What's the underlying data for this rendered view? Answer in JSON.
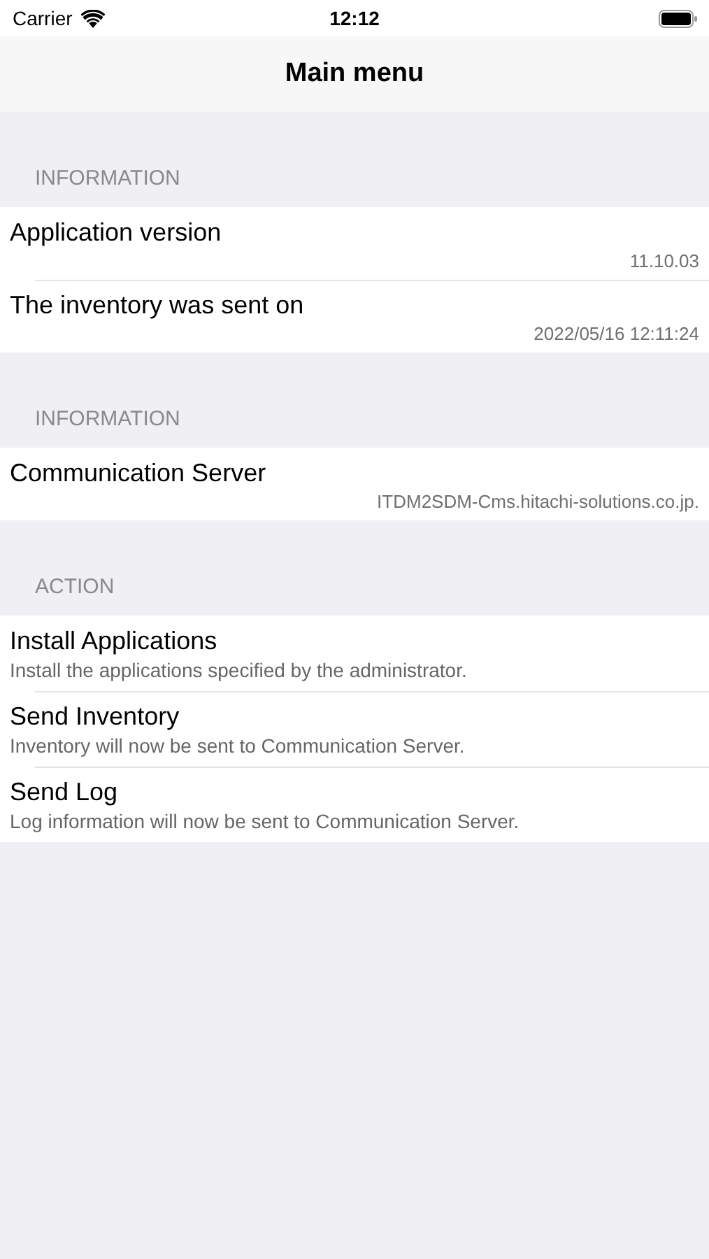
{
  "status_bar": {
    "carrier": "Carrier",
    "time": "12:12"
  },
  "nav_bar": {
    "title": "Main menu"
  },
  "sections": [
    {
      "header": "INFORMATION",
      "rows": [
        {
          "kind": "info",
          "title": "Application version",
          "value": "11.10.03"
        },
        {
          "kind": "info",
          "title": "The inventory was sent on",
          "value": "2022/05/16 12:11:24"
        }
      ]
    },
    {
      "header": "INFORMATION",
      "rows": [
        {
          "kind": "info",
          "title": "Communication Server",
          "value": "ITDM2SDM-Cms.hitachi-solutions.co.jp."
        }
      ]
    },
    {
      "header": "ACTION",
      "rows": [
        {
          "kind": "action",
          "title": "Install Applications",
          "subtitle": "Install the applications specified by the administrator."
        },
        {
          "kind": "action",
          "title": "Send Inventory",
          "subtitle": "Inventory will now be sent to Communication Server."
        },
        {
          "kind": "action",
          "title": "Send Log",
          "subtitle": "Log information will now be sent to Communication Server."
        }
      ]
    }
  ]
}
